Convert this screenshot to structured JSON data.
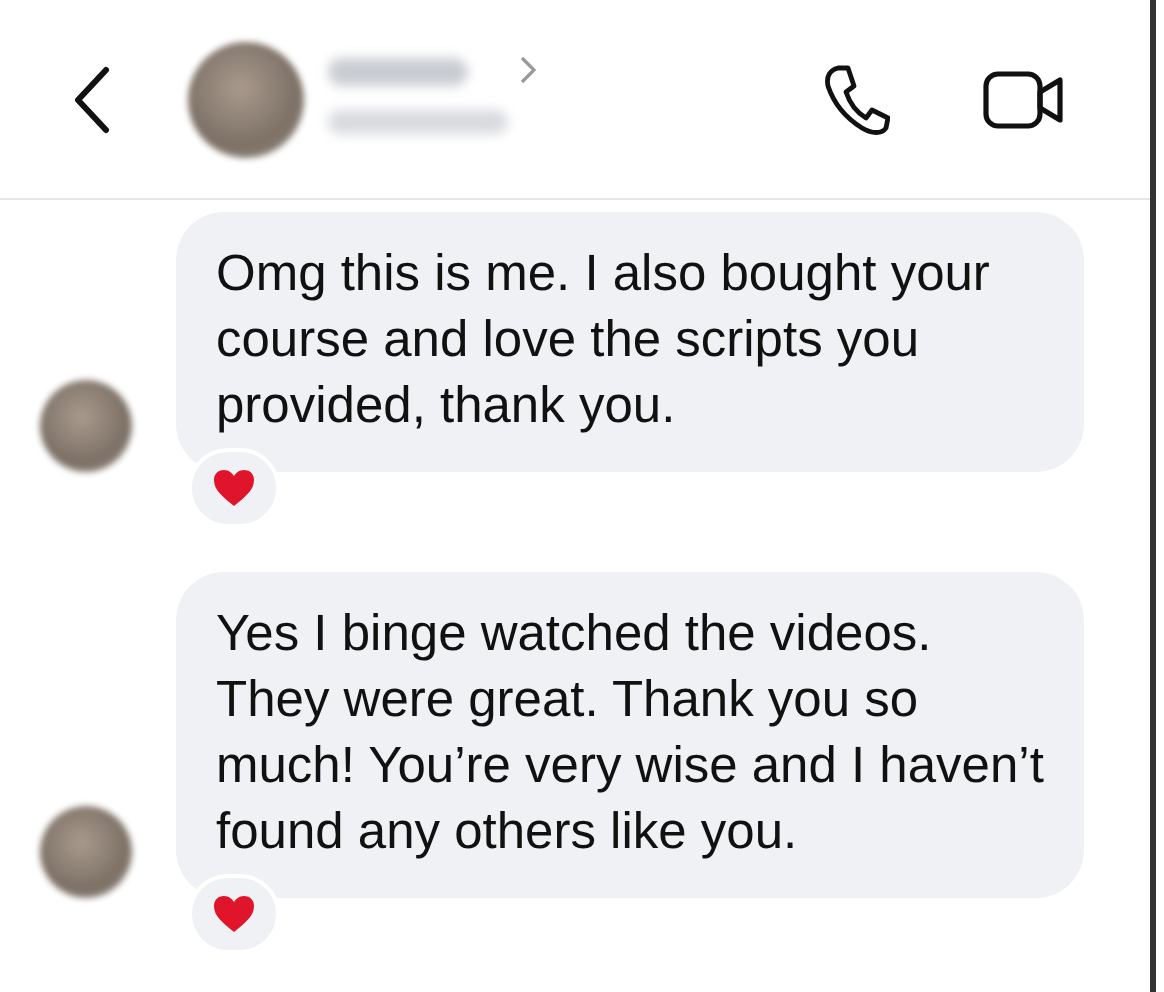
{
  "messages": [
    {
      "text": "Omg this is me. I also bought your course and love the scripts you provided, thank you.",
      "reacted": true
    },
    {
      "text": "Yes I binge watched the videos. They were great. Thank you so much! You’re very wise and I haven’t found any others like you.",
      "reacted": true
    }
  ]
}
